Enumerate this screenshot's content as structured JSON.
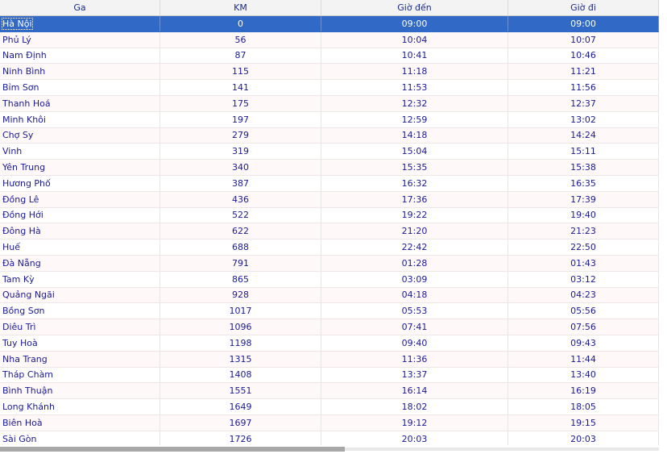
{
  "columns": [
    "Ga",
    "KM",
    "Giờ đến",
    "Giờ đi"
  ],
  "rows": [
    [
      "Hà Nội",
      "0",
      "09:00",
      "09:00"
    ],
    [
      "Phủ Lý",
      "56",
      "10:04",
      "10:07"
    ],
    [
      "Nam Định",
      "87",
      "10:41",
      "10:46"
    ],
    [
      "Ninh Bình",
      "115",
      "11:18",
      "11:21"
    ],
    [
      "Bỉm Sơn",
      "141",
      "11:53",
      "11:56"
    ],
    [
      "Thanh Hoá",
      "175",
      "12:32",
      "12:37"
    ],
    [
      "Minh Khôi",
      "197",
      "12:59",
      "13:02"
    ],
    [
      "Chợ Sy",
      "279",
      "14:18",
      "14:24"
    ],
    [
      "Vinh",
      "319",
      "15:04",
      "15:11"
    ],
    [
      "Yên Trung",
      "340",
      "15:35",
      "15:38"
    ],
    [
      "Hương Phố",
      "387",
      "16:32",
      "16:35"
    ],
    [
      "Đồng Lê",
      "436",
      "17:36",
      "17:39"
    ],
    [
      "Đồng Hới",
      "522",
      "19:22",
      "19:40"
    ],
    [
      "Đông Hà",
      "622",
      "21:20",
      "21:23"
    ],
    [
      "Huế",
      "688",
      "22:42",
      "22:50"
    ],
    [
      "Đà Nẵng",
      "791",
      "01:28",
      "01:43"
    ],
    [
      "Tam Kỳ",
      "865",
      "03:09",
      "03:12"
    ],
    [
      "Quảng Ngãi",
      "928",
      "04:18",
      "04:23"
    ],
    [
      "Bồng Sơn",
      "1017",
      "05:53",
      "05:56"
    ],
    [
      "Diêu Trì",
      "1096",
      "07:41",
      "07:56"
    ],
    [
      "Tuy Hoà",
      "1198",
      "09:40",
      "09:43"
    ],
    [
      "Nha Trang",
      "1315",
      "11:36",
      "11:44"
    ],
    [
      "Tháp Chàm",
      "1408",
      "13:37",
      "13:40"
    ],
    [
      "Bình Thuận",
      "1551",
      "16:14",
      "16:19"
    ],
    [
      "Long Khánh",
      "1649",
      "18:02",
      "18:05"
    ],
    [
      "Biên Hoà",
      "1697",
      "19:12",
      "19:15"
    ],
    [
      "Sài Gòn",
      "1726",
      "20:03",
      "20:03"
    ]
  ],
  "selected_row": 0,
  "colors": {
    "selection": "#3169c6",
    "text": "#1a1a96",
    "header_text": "#1a2a8a"
  }
}
